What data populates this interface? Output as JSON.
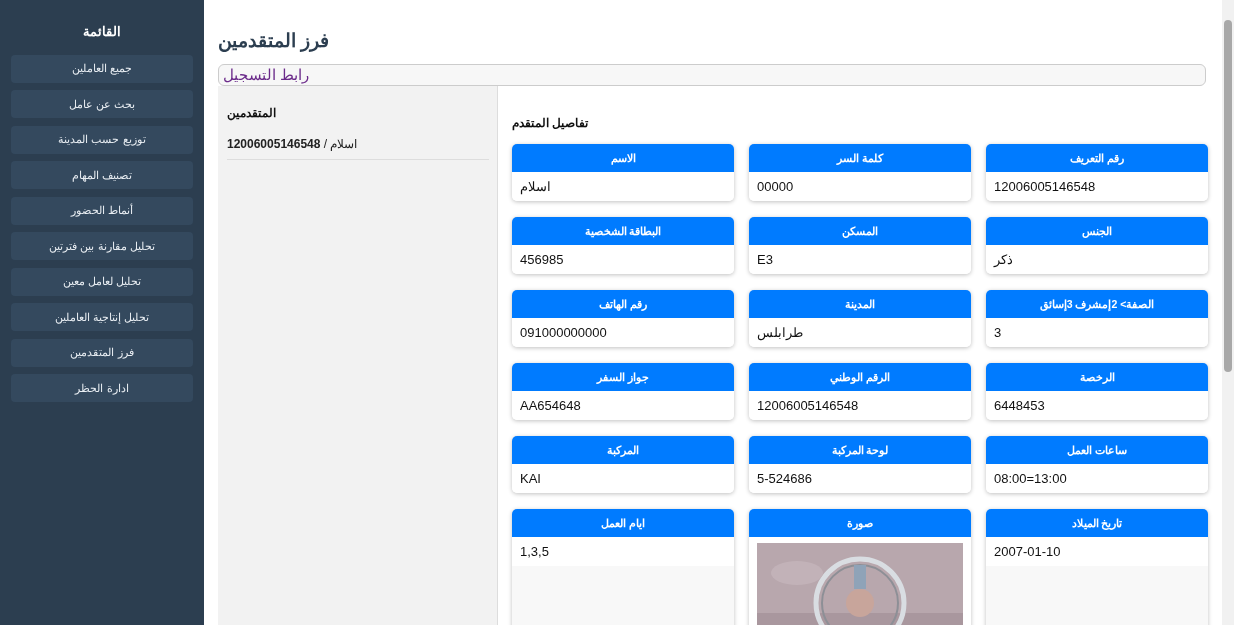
{
  "sidebar": {
    "title": "القائمة",
    "items": [
      "جميع العاملين",
      "بحث عن عامل",
      "توزيع حسب المدينة",
      "تصنيف المهام",
      "أنماط الحضور",
      "تحليل مقارنة بين فترتين",
      "تحليل لعامل معين",
      "تحليل إنتاجية العاملين",
      "فرز المتقدمين",
      "ادارة الحظر"
    ]
  },
  "page_title": "فرز المتقدمين",
  "registration_link": "رابط التسجيل",
  "applicants": {
    "title": "المتقدمين",
    "items": [
      "**12006005146548** / اسلام"
    ]
  },
  "details": {
    "title": "تفاصيل المتقدم",
    "fields": [
      {
        "label": "رقم التعريف",
        "value": "12006005146548",
        "kind": "text"
      },
      {
        "label": "كلمة السر",
        "value": "00000",
        "kind": "text"
      },
      {
        "label": "الاسم",
        "value": "اسلام",
        "kind": "text"
      },
      {
        "label": "الجنس",
        "value": "ذكر",
        "kind": "text"
      },
      {
        "label": "المسكن",
        "value": "E3",
        "kind": "text"
      },
      {
        "label": "البطاقة الشخصية",
        "value": "456985",
        "kind": "text"
      },
      {
        "label": "الصفة> 2إمشرف 3إسائق",
        "value": "3",
        "kind": "text"
      },
      {
        "label": "المدينة",
        "value": "طرابلس",
        "kind": "text"
      },
      {
        "label": "رقم الهاتف",
        "value": "091000000000",
        "kind": "text"
      },
      {
        "label": "الرخصة",
        "value": "6448453",
        "kind": "text"
      },
      {
        "label": "الرقم الوطني",
        "value": "12006005146548",
        "kind": "text"
      },
      {
        "label": "جواز السفر",
        "value": "AA654648",
        "kind": "text"
      },
      {
        "label": "ساعات العمل",
        "value": "08:00=13:00",
        "kind": "text"
      },
      {
        "label": "لوحة المركبة",
        "value": "5-524686",
        "kind": "text"
      },
      {
        "label": "المركبة",
        "value": "KAI",
        "kind": "text"
      },
      {
        "label": "تاريخ الميلاد",
        "value": "2007-01-10",
        "kind": "text"
      },
      {
        "label": "صورة",
        "kind": "picture"
      },
      {
        "label": "ايام العمل",
        "value": "1,3,5",
        "kind": "text"
      }
    ]
  }
}
